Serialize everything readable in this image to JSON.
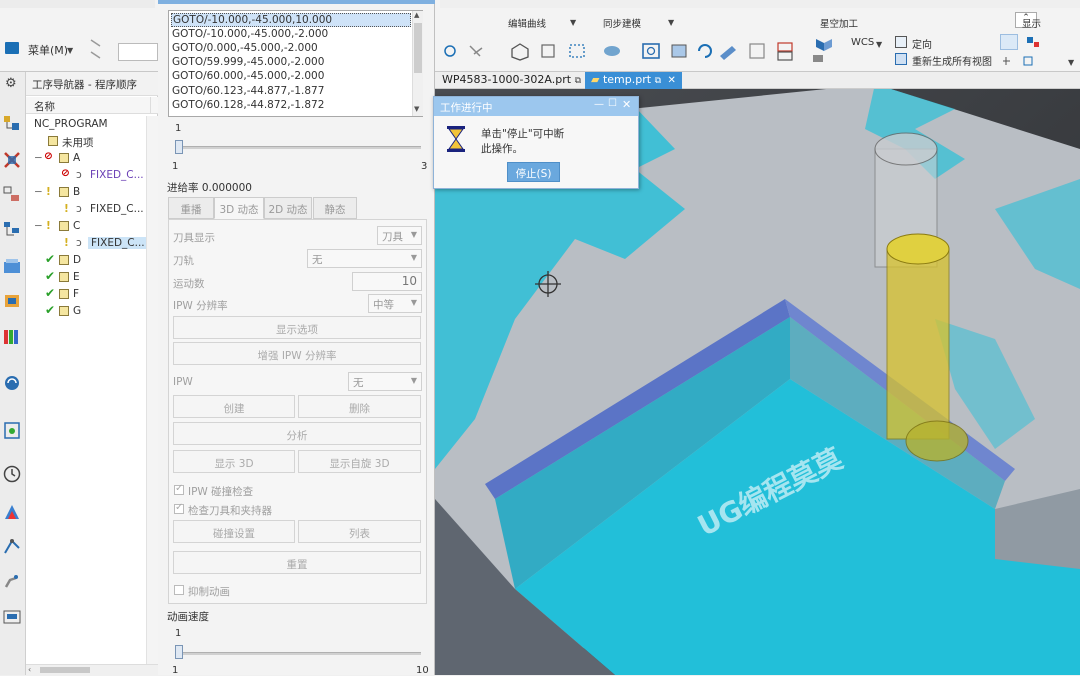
{
  "ribbon": {
    "groups": {
      "edit_curve": "编辑曲线",
      "sync_model": "同步建模",
      "star_process": "星空加工",
      "display": "显示"
    },
    "menu_label": "菜单(M)",
    "wcs_label": "WCS",
    "orient_label": "定向",
    "regen_label": "重新生成所有视图"
  },
  "file_tabs": [
    {
      "label": "WP4583-1000-302A.prt"
    },
    {
      "label": "temp.prt"
    }
  ],
  "navigator": {
    "title": "工序导航器 - 程序顺序",
    "column": "名称",
    "rows": [
      {
        "label": "NC_PROGRAM"
      },
      {
        "label": "未用项"
      },
      {
        "label": "A"
      },
      {
        "label": "FIXED_C..."
      },
      {
        "label": "B"
      },
      {
        "label": "FIXED_C..."
      },
      {
        "label": "C"
      },
      {
        "label": "FIXED_C..."
      },
      {
        "label": "D"
      },
      {
        "label": "E"
      },
      {
        "label": "F"
      },
      {
        "label": "G"
      }
    ]
  },
  "panel": {
    "goto_lines": [
      "GOTO/-10.000,-45.000,10.000",
      "GOTO/-10.000,-45.000,-2.000",
      "GOTO/0.000,-45.000,-2.000",
      "GOTO/59.999,-45.000,-2.000",
      "GOTO/60.000,-45.000,-2.000",
      "GOTO/60.123,-44.877,-1.877",
      "GOTO/60.128,-44.872,-1.872"
    ],
    "slider1": {
      "current": "1",
      "min": "1",
      "max": "3",
      "value_fraction": 0.0
    },
    "feed_rate": "进给率 0.000000",
    "tabs": [
      "重播",
      "3D 动态",
      "2D 动态",
      "静态"
    ],
    "tool_display_label": "刀具显示",
    "tool_display_value": "刀具",
    "tool_path_label": "刀轨",
    "tool_path_value": "无",
    "motion_count_label": "运动数",
    "motion_count_value": "10",
    "ipw_res_label": "IPW 分辨率",
    "ipw_res_value": "中等",
    "btn_show_options": "显示选项",
    "btn_enhance_ipw": "增强 IPW 分辨率",
    "ipw_label": "IPW",
    "ipw_value": "无",
    "btn_create": "创建",
    "btn_delete": "删除",
    "btn_analyze": "分析",
    "btn_show3d": "显示 3D",
    "btn_show_auto3d": "显示自旋 3D",
    "chk_ipw_collision": "IPW 碰撞检查",
    "chk_check_tool": "检查刀具和夹持器",
    "btn_collision_settings": "碰撞设置",
    "btn_list": "列表",
    "btn_reset": "重置",
    "chk_suppress_anim": "抑制动画",
    "anim_speed_label": "动画速度",
    "slider2": {
      "current": "1",
      "min": "1",
      "max": "10",
      "value_fraction": 0.0
    }
  },
  "progress_dialog": {
    "title": "工作进行中",
    "message_line1": "单击\"停止\"可中断",
    "message_line2": "此操作。",
    "stop_button": "停止(S)"
  },
  "viewport": {
    "watermark": "UG编程莫莫"
  },
  "colors": {
    "cyan": "#23bdd6",
    "tool_yellow": "#d4c22a",
    "accent_blue": "#6aa8de"
  }
}
